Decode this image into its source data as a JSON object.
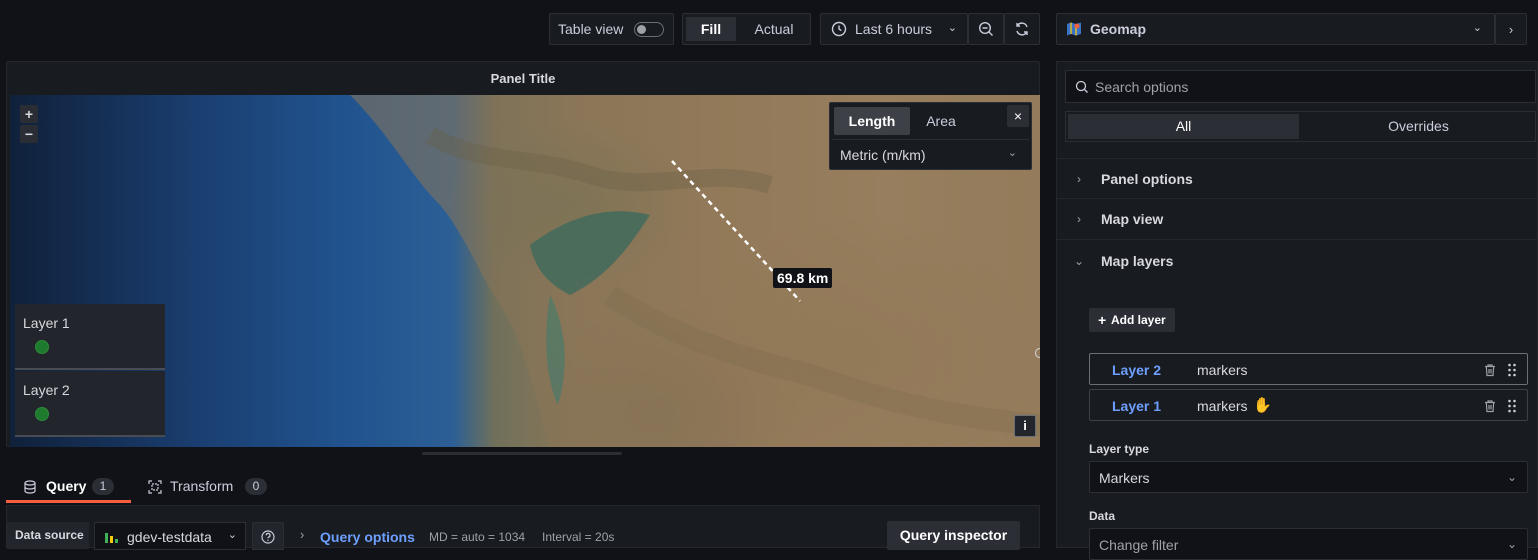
{
  "toolbar": {
    "table_view_label": "Table view",
    "fill_label": "Fill",
    "actual_label": "Actual",
    "time_range": "Last 6 hours",
    "visualization": "Geomap"
  },
  "panel": {
    "title": "Panel Title",
    "zoom_in": "+",
    "zoom_out": "−",
    "measure": {
      "tab_length": "Length",
      "tab_area": "Area",
      "units": "Metric (m/km)",
      "close": "×"
    },
    "distance_label": "69.8 km",
    "info": "i",
    "legend": [
      {
        "label": "Layer 1"
      },
      {
        "label": "Layer 2"
      }
    ]
  },
  "bottom": {
    "query_tab": "Query",
    "query_count": "1",
    "transform_tab": "Transform",
    "transform_count": "0",
    "data_source_label": "Data source",
    "data_source_value": "gdev-testdata",
    "query_options": "Query options",
    "md": "MD = auto = 1034",
    "interval": "Interval = 20s",
    "query_inspector": "Query inspector"
  },
  "options": {
    "search_placeholder": "Search options",
    "tab_all": "All",
    "tab_overrides": "Overrides",
    "sections": [
      {
        "label": "Panel options"
      },
      {
        "label": "Map view"
      },
      {
        "label": "Map layers"
      }
    ],
    "add_layer": "Add layer",
    "layers": [
      {
        "name": "Layer 2",
        "type": "markers"
      },
      {
        "name": "Layer 1",
        "type": "markers"
      }
    ],
    "layer_type_label": "Layer type",
    "layer_type_value": "Markers",
    "data_label": "Data",
    "data_placeholder": "Change filter"
  },
  "colors": {
    "accent_blue": "#6e9fff",
    "active_tab_underline": "#f55f3e",
    "marker_green": "#1e7a2d"
  }
}
